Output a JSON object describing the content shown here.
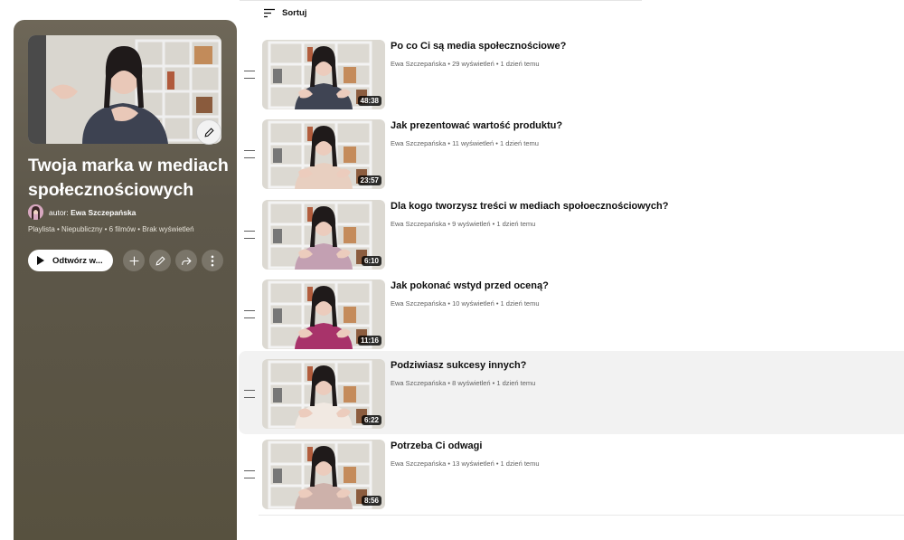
{
  "colors": {
    "panel_bg": "#5e584b",
    "hover_row": "#f2f2f2",
    "meta_text": "#606060"
  },
  "playlist": {
    "title": "Twoja marka w mediach społecznościowych",
    "author_prefix": "autor:",
    "author_name": "Ewa Szczepańska",
    "meta": "Playlista • Niepubliczny • 6 filmów • Brak wyświetleń",
    "play_label": "Odtwórz w...",
    "icons": {
      "edit_thumbnail": "pencil-icon",
      "add": "plus-icon",
      "edit": "pencil-icon",
      "share": "share-icon",
      "more": "more-vertical-icon"
    }
  },
  "sort_label": "Sortuj",
  "videos": [
    {
      "title": "Po co Ci są media społecznościowe?",
      "meta": "Ewa Szczepańska • 29 wyświetleń • 1 dzień temu",
      "duration": "48:38",
      "sweater": "#3f4453"
    },
    {
      "title": "Jak prezentować wartość produktu?",
      "meta": "Ewa Szczepańska • 11 wyświetleń • 1 dzień temu",
      "duration": "23:57",
      "sweater": "#e8cfc0"
    },
    {
      "title": "Dla kogo tworzysz treści w mediach społoecznościowych?",
      "meta": "Ewa Szczepańska • 9 wyświetleń • 1 dzień temu",
      "duration": "6:10",
      "sweater": "#c3a0b2"
    },
    {
      "title": "Jak pokonać wstyd przed oceną?",
      "meta": "Ewa Szczepańska • 10 wyświetleń • 1 dzień temu",
      "duration": "11:16",
      "sweater": "#a8336a"
    },
    {
      "title": "Podziwiasz sukcesy innych?",
      "meta": "Ewa Szczepańska • 8 wyświetleń • 1 dzień temu",
      "duration": "6:22",
      "sweater": "#f1e9e2"
    },
    {
      "title": "Potrzeba Ci odwagi",
      "meta": "Ewa Szczepańska • 13 wyświetleń • 1 dzień temu",
      "duration": "8:56",
      "sweater": "#cdb1aa"
    }
  ]
}
